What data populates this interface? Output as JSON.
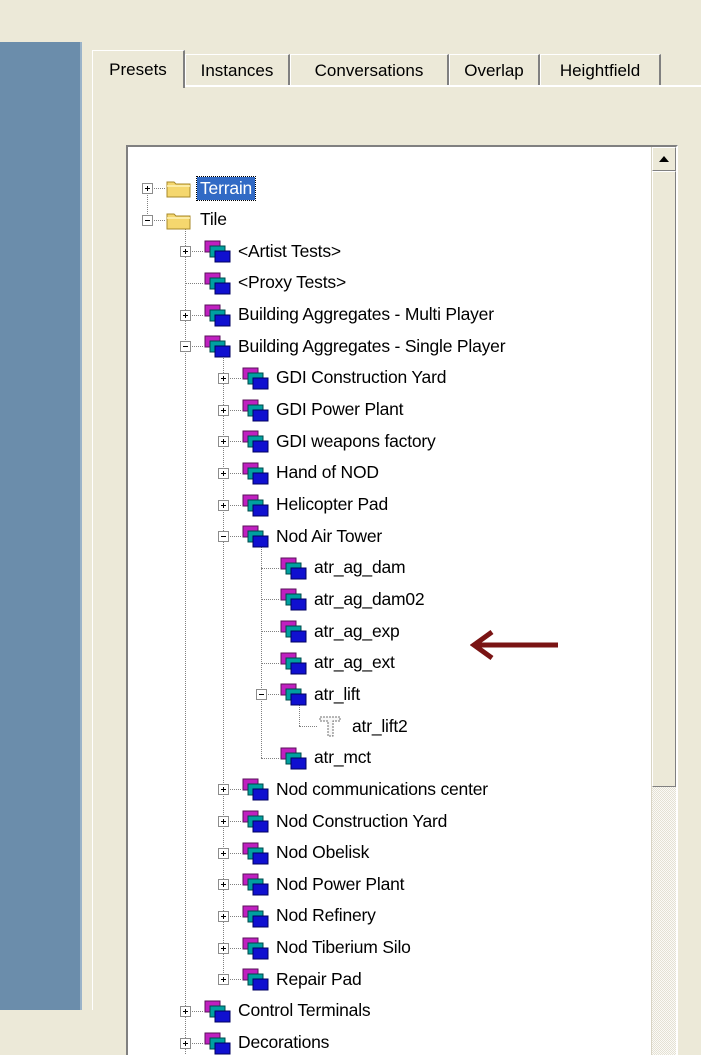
{
  "tabs": [
    {
      "label": "Presets",
      "active": true
    },
    {
      "label": "Instances",
      "active": false
    },
    {
      "label": "Conversations",
      "active": false
    },
    {
      "label": "Overlap",
      "active": false
    },
    {
      "label": "Heightfield",
      "active": false
    }
  ],
  "tree": {
    "terrain": "Terrain",
    "tile": "Tile",
    "artist_tests": "<Artist Tests>",
    "proxy_tests": "<Proxy Tests>",
    "ba_multi": "Building Aggregates - Multi Player",
    "ba_single": "Building Aggregates - Single Player",
    "gdi_cy": "GDI Construction Yard",
    "gdi_pp": "GDI Power Plant",
    "gdi_wf": "GDI weapons factory",
    "hand_nod": "Hand of NOD",
    "heli_pad": "Helicopter Pad",
    "nod_air": "Nod Air Tower",
    "atr_ag_dam": "atr_ag_dam",
    "atr_ag_dam02": "atr_ag_dam02",
    "atr_ag_exp": "atr_ag_exp",
    "atr_ag_ext": "atr_ag_ext",
    "atr_lift": "atr_lift",
    "atr_lift2": "atr_lift2",
    "atr_mct": "atr_mct",
    "nod_comm": "Nod communications center",
    "nod_cy": "Nod Construction Yard",
    "nod_obelisk": "Nod Obelisk",
    "nod_pp": "Nod Power Plant",
    "nod_ref": "Nod Refinery",
    "nod_silo": "Nod Tiberium Silo",
    "repair_pad": "Repair Pad",
    "control_terminals": "Control Terminals",
    "decorations": "Decorations"
  },
  "colors": {
    "left_strip": "#6b8dab",
    "dialog_bg": "#ece9d8",
    "selection": "#316ac5",
    "annotation_arrow": "#7a1414"
  },
  "icons": {
    "folder": "folder-icon",
    "preset": "preset-stack-icon",
    "lift": "lift-object-icon"
  }
}
